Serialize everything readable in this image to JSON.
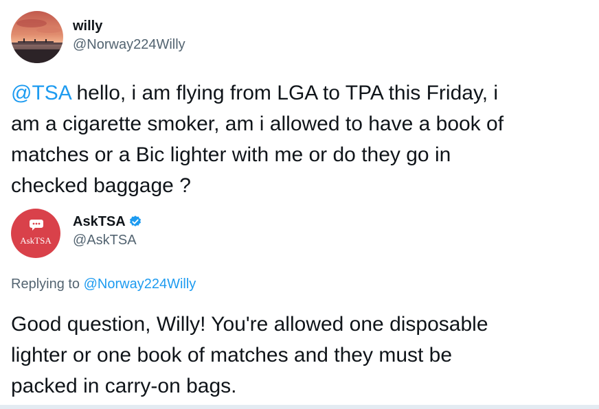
{
  "tweet": {
    "author": {
      "display_name": "willy",
      "handle": "@Norway224Willy",
      "avatar_icon": "sunset-pier-photo"
    },
    "mention": "@TSA",
    "text_line1": " hello, i am flying from LGA to TPA this Friday, i",
    "text_line2": "am a cigarette smoker, am i allowed to have a book of",
    "text_line3": "matches or a Bic lighter with me or do they go in",
    "text_line4": "checked baggage ?"
  },
  "reply": {
    "author": {
      "display_name": "AskTSA",
      "handle": "@AskTSA",
      "avatar_logo_text": "AskTSA",
      "avatar_color": "#d9414a",
      "verified_icon": "verified-badge-icon"
    },
    "replying_to_label": "Replying to ",
    "replying_to_handle": "@Norway224Willy",
    "text_line1": "Good question, Willy! You're allowed one disposable",
    "text_line2": "lighter or one book of matches and they must be",
    "text_line3": "packed in carry-on bags."
  },
  "colors": {
    "link": "#1d9bf0",
    "secondary_text": "#536471",
    "primary_text": "#0f1419"
  }
}
